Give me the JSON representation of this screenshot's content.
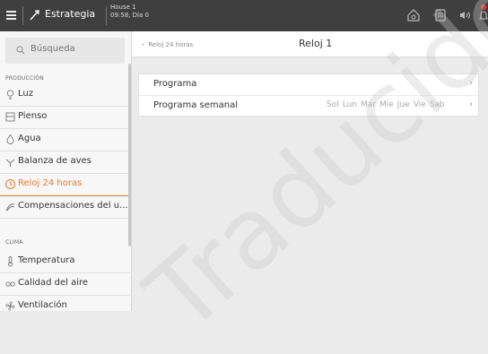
{
  "topbar": {
    "title": "Estrategia",
    "house_name": "House 1",
    "house_time": "09:58, Día 0",
    "notification_count": 1
  },
  "sidebar": {
    "search_placeholder": "Búsqueda",
    "sections": [
      {
        "label": "PRODUCCIÓN",
        "items": [
          {
            "label": "Luz",
            "icon": "bulb-icon"
          },
          {
            "label": "Pienso",
            "icon": "feed-icon"
          },
          {
            "label": "Agua",
            "icon": "water-drop-icon"
          },
          {
            "label": "Balanza de aves",
            "icon": "bird-scale-icon"
          },
          {
            "label": "Reloj 24 horas",
            "icon": "clock-icon",
            "active": true
          },
          {
            "label": "Compensaciones del u...",
            "icon": "compensation-icon"
          }
        ]
      },
      {
        "label": "CLIMA",
        "items": [
          {
            "label": "Temperatura",
            "icon": "thermometer-icon"
          },
          {
            "label": "Calidad del aire",
            "icon": "co2-icon"
          },
          {
            "label": "Ventilación",
            "icon": "fan-icon"
          }
        ]
      }
    ]
  },
  "main": {
    "breadcrumb_back": "Reloj 24 horas",
    "title": "Reloj 1",
    "rows": [
      {
        "label": "Programa"
      },
      {
        "label": "Programa semanal",
        "days": [
          "Sol",
          "Lun",
          "Mar",
          "Mie",
          "Jue",
          "Vie",
          "Sab"
        ]
      }
    ]
  },
  "watermark": "Traducido",
  "colors": {
    "accent": "#e87a2e",
    "topbar": "#3f3f3f",
    "badge": "#e23b2e"
  }
}
